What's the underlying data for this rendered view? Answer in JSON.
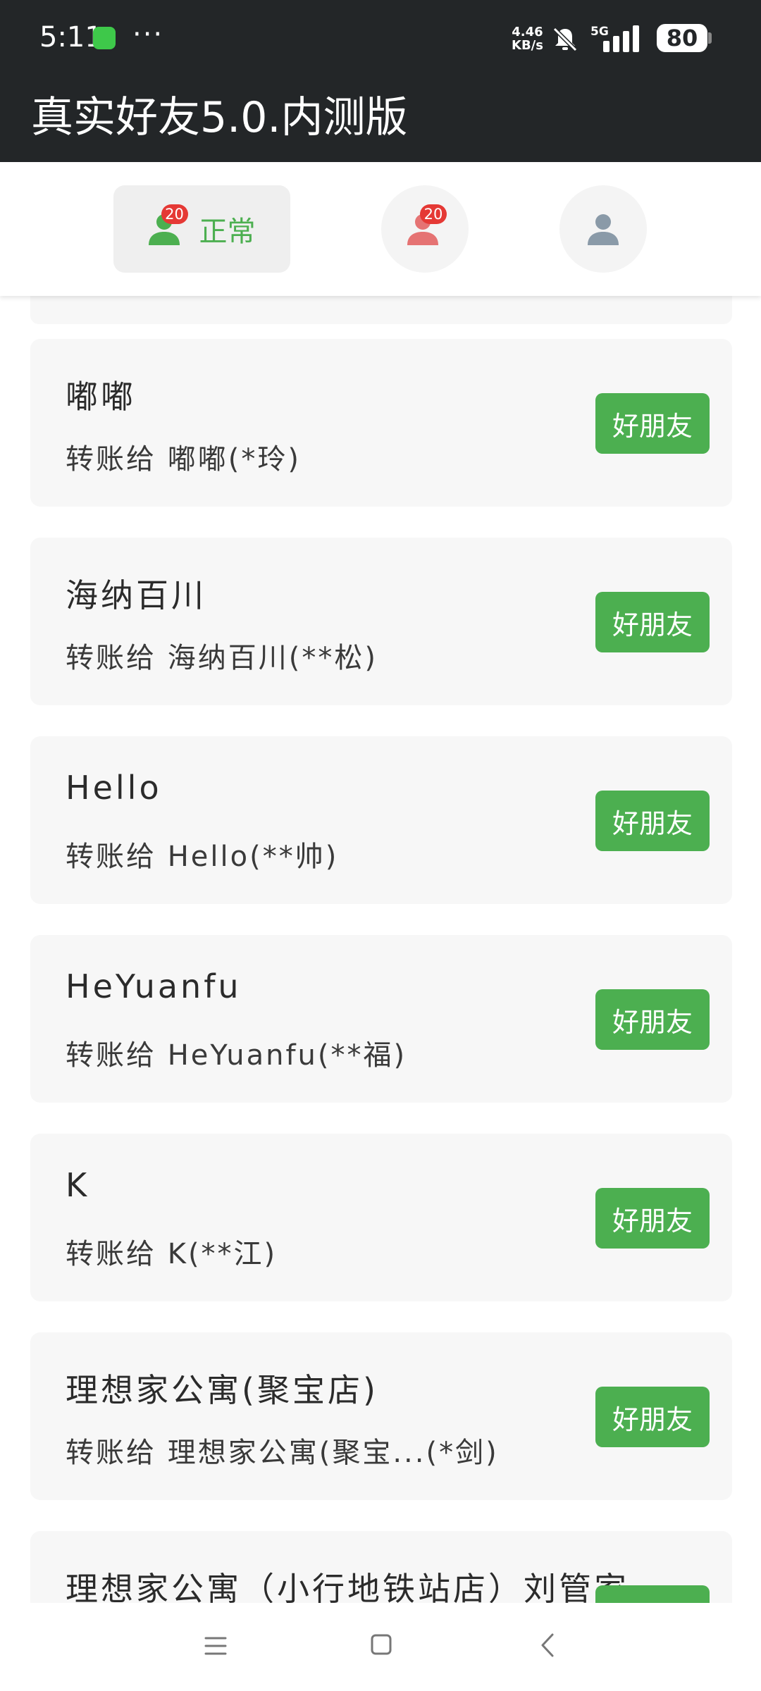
{
  "status_bar": {
    "time": "5:11",
    "more": "···",
    "net_speed_value": "4.46",
    "net_speed_unit": "KB/s",
    "network": "5G",
    "battery": "80"
  },
  "app": {
    "title": "真实好友5.0.内测版"
  },
  "tabs": {
    "normal": {
      "label": "正常",
      "badge": "20"
    },
    "red": {
      "badge": "20"
    }
  },
  "colors": {
    "header_bg": "#232628",
    "accent_green": "#4caf50",
    "badge_red": "#e53935",
    "red_person": "#e57373",
    "gray_person": "#8a9aa8",
    "card_bg": "#f7f7f7"
  },
  "friends": [
    {
      "name": "嘟嘟",
      "subtitle": "转账给 嘟嘟(*玲)",
      "button": "好朋友"
    },
    {
      "name": "海纳百川",
      "subtitle": "转账给 海纳百川(**松)",
      "button": "好朋友"
    },
    {
      "name": "Hello",
      "subtitle": "转账给 Hello(**帅)",
      "button": "好朋友"
    },
    {
      "name": "HeYuanfu",
      "subtitle": "转账给 HeYuanfu(**福)",
      "button": "好朋友"
    },
    {
      "name": "K",
      "subtitle": "转账给 K(**江)",
      "button": "好朋友"
    },
    {
      "name": "理想家公寓(聚宝店)",
      "subtitle": "转账给 理想家公寓(聚宝...(*剑)",
      "button": "好朋友"
    },
    {
      "name": "理想家公寓（小行地铁站店）刘管家",
      "subtitle": "",
      "button": ""
    }
  ]
}
